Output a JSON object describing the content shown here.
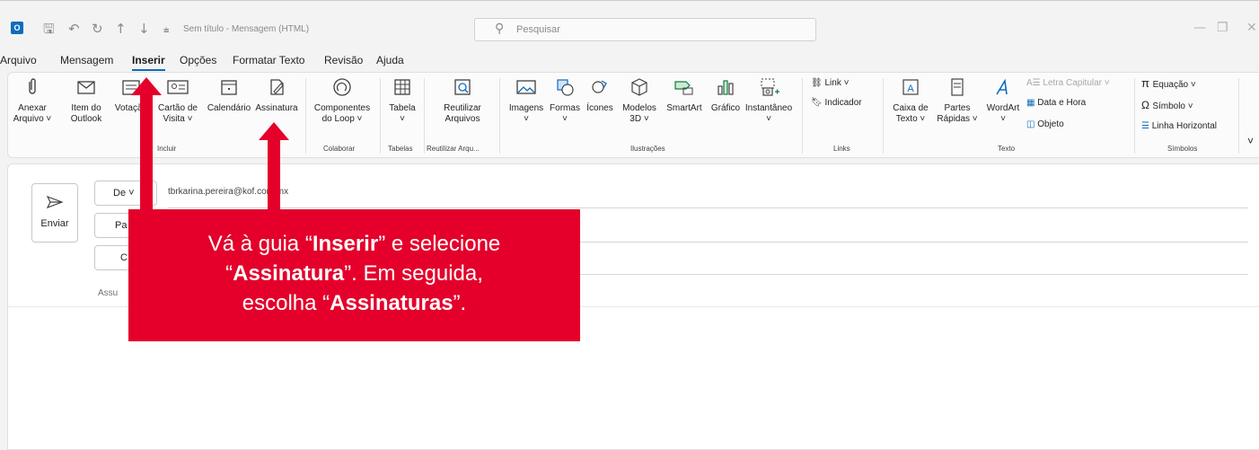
{
  "titlebar": {
    "title": "Sem título  -  Mensagem (HTML)",
    "search_placeholder": "Pesquisar",
    "logo_letter": "O"
  },
  "tabs": [
    "Arquivo",
    "Mensagem",
    "Inserir",
    "Opções",
    "Formatar Texto",
    "Revisão",
    "Ajuda"
  ],
  "active_tab": "Inserir",
  "ribbon": {
    "anexar": [
      "Anexar",
      "Arquivo ˅"
    ],
    "item_outlook": [
      "Item do",
      "Outlook"
    ],
    "votacao": "Votação",
    "cartao": [
      "Cartão de",
      "Visita ˅"
    ],
    "calendario": "Calendário",
    "assinatura": "Assinatura",
    "componentes": [
      "Componentes",
      "do Loop ˅"
    ],
    "tabela": [
      "Tabela",
      "˅"
    ],
    "reutilizar": [
      "Reutilizar",
      "Arquivos"
    ],
    "imagens": [
      "Imagens",
      "˅"
    ],
    "formas": [
      "Formas",
      "˅"
    ],
    "icones": "Ícones",
    "modelos": [
      "Modelos",
      "3D ˅"
    ],
    "smartart": "SmartArt",
    "grafico": "Gráfico",
    "instantaneo": [
      "Instantâneo",
      "˅"
    ],
    "link": "Link  ˅",
    "indicador": "Indicador",
    "caixa_texto": [
      "Caixa de",
      "Texto ˅"
    ],
    "partes_rapidas": [
      "Partes",
      "Rápidas ˅"
    ],
    "wordart": [
      "WordArt",
      "˅"
    ],
    "letra_capitular": "Letra Capitular ˅",
    "data_hora": "Data e Hora",
    "objeto": "Objeto",
    "equacao": "Equação  ˅",
    "simbolo": "Símbolo ˅",
    "linha_horizontal": "Linha Horizontal",
    "groups": {
      "incluir": "Incluir",
      "colaborar": "Colaborar",
      "tabelas": "Tabelas",
      "reutilizar": "Reutilizar Arqu...",
      "ilustracoes": "Ilustrações",
      "links": "Links",
      "texto": "Texto",
      "simbolos": "Símbolos"
    }
  },
  "compose": {
    "send_label": "Enviar",
    "from_label": "De",
    "from_value": "tbrkarina.pereira@kof.com.mx",
    "to_label_partial": "Pa",
    "cc_label_partial": "C",
    "subject_partial": "Assu"
  },
  "callout": {
    "line1_pre": "Vá à guia “",
    "line1_bold": "Inserir",
    "line1_post": "” e selecione",
    "line2_pre": "“",
    "line2_bold": "Assinatura",
    "line2_post": "”. Em seguida,",
    "line3_pre": "escolha “",
    "line3_bold": "Assinaturas",
    "line3_post": "”."
  },
  "colors": {
    "accent": "#0f6cbd",
    "callout": "#e4002b"
  }
}
